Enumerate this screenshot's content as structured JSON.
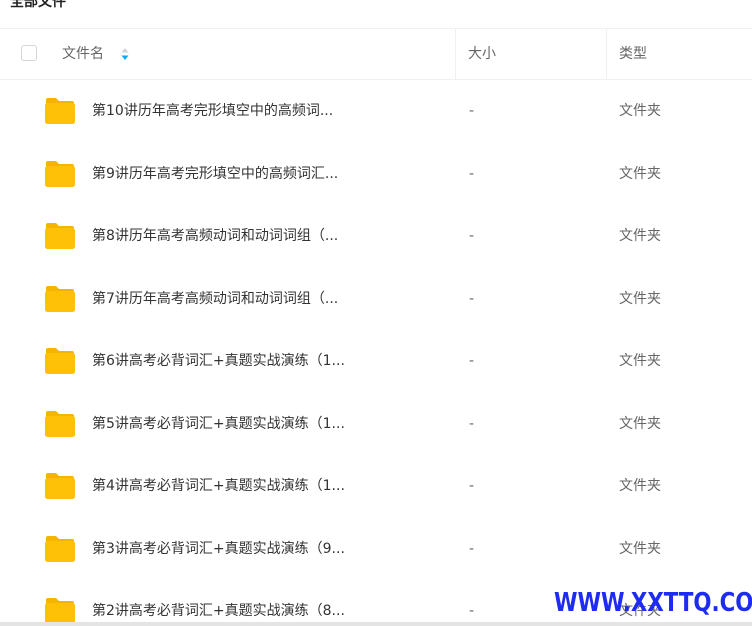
{
  "breadcrumb": "全部文件",
  "header": {
    "name": "文件名",
    "size": "大小",
    "type": "类型"
  },
  "files": [
    {
      "name": "第10讲历年高考完形填空中的高频词...",
      "size": "-",
      "type": "文件夹"
    },
    {
      "name": "第9讲历年高考完形填空中的高频词汇...",
      "size": "-",
      "type": "文件夹"
    },
    {
      "name": "第8讲历年高考高频动词和动词词组（...",
      "size": "-",
      "type": "文件夹"
    },
    {
      "name": "第7讲历年高考高频动词和动词词组（...",
      "size": "-",
      "type": "文件夹"
    },
    {
      "name": "第6讲高考必背词汇+真题实战演练（1...",
      "size": "-",
      "type": "文件夹"
    },
    {
      "name": "第5讲高考必背词汇+真题实战演练（1...",
      "size": "-",
      "type": "文件夹"
    },
    {
      "name": "第4讲高考必背词汇+真题实战演练（1...",
      "size": "-",
      "type": "文件夹"
    },
    {
      "name": "第3讲高考必背词汇+真题实战演练（9...",
      "size": "-",
      "type": "文件夹"
    },
    {
      "name": "第2讲高考必背词汇+真题实战演练（8...",
      "size": "-",
      "type": "文件夹"
    }
  ],
  "icons": {
    "folder": "folder-icon",
    "sort": "sort-icon"
  },
  "colors": {
    "folder": "#ffc107",
    "folder_dark": "#f5b400",
    "sort": "#06a7ff",
    "watermark": "#1d2cf0"
  },
  "watermark": "WWW.XXTTQ.COM"
}
